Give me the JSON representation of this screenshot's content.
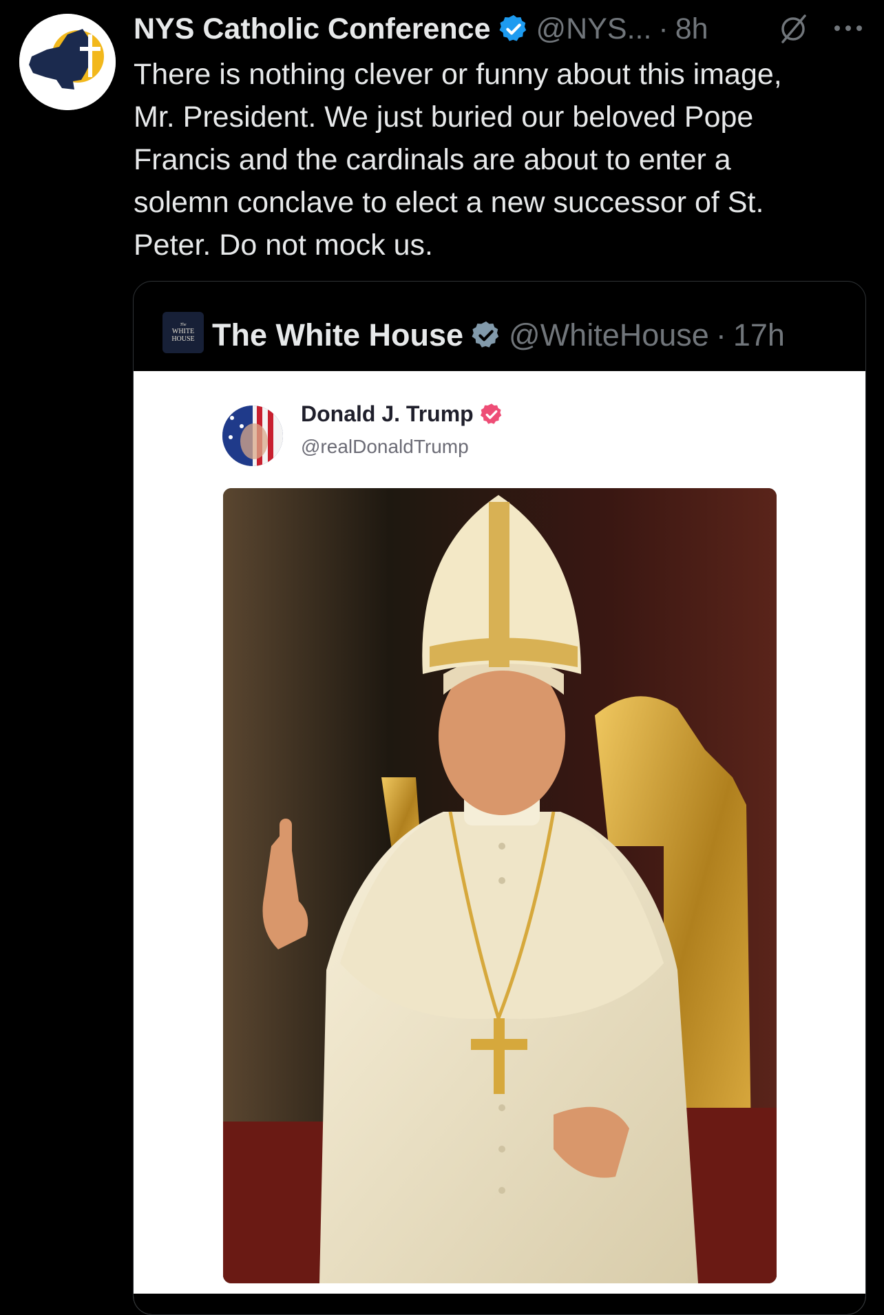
{
  "post": {
    "author_name": "NYS Catholic Conference",
    "handle": "@NYS...",
    "separator": "·",
    "time": "8h",
    "text": "There is nothing clever or funny about this image,\nMr. President. We just buried our beloved Pope\nFrancis and the cardinals are about to enter a\nsolemn conclave to elect a new successor of St.\nPeter. Do not mock us."
  },
  "quote": {
    "author_name": "The White House",
    "handle": "@WhiteHouse",
    "separator": "·",
    "time": "17h",
    "logo_text_top": "The",
    "logo_text_line1": "WHITE",
    "logo_text_line2": "HOUSE"
  },
  "media": {
    "inner_name": "Donald J. Trump",
    "inner_handle": "@realDonaldTrump"
  },
  "colors": {
    "background": "#000000",
    "text": "#e7e9ea",
    "secondary_text": "#71767b",
    "verified_blue": "#1d9bf0",
    "truth_pink": "#ee4d76",
    "org_navy": "#1b2a4e",
    "org_gold": "#f2b81c"
  },
  "icons": {
    "verified": "verified-badge-icon",
    "grok": "grok-icon",
    "more": "more-icon"
  }
}
